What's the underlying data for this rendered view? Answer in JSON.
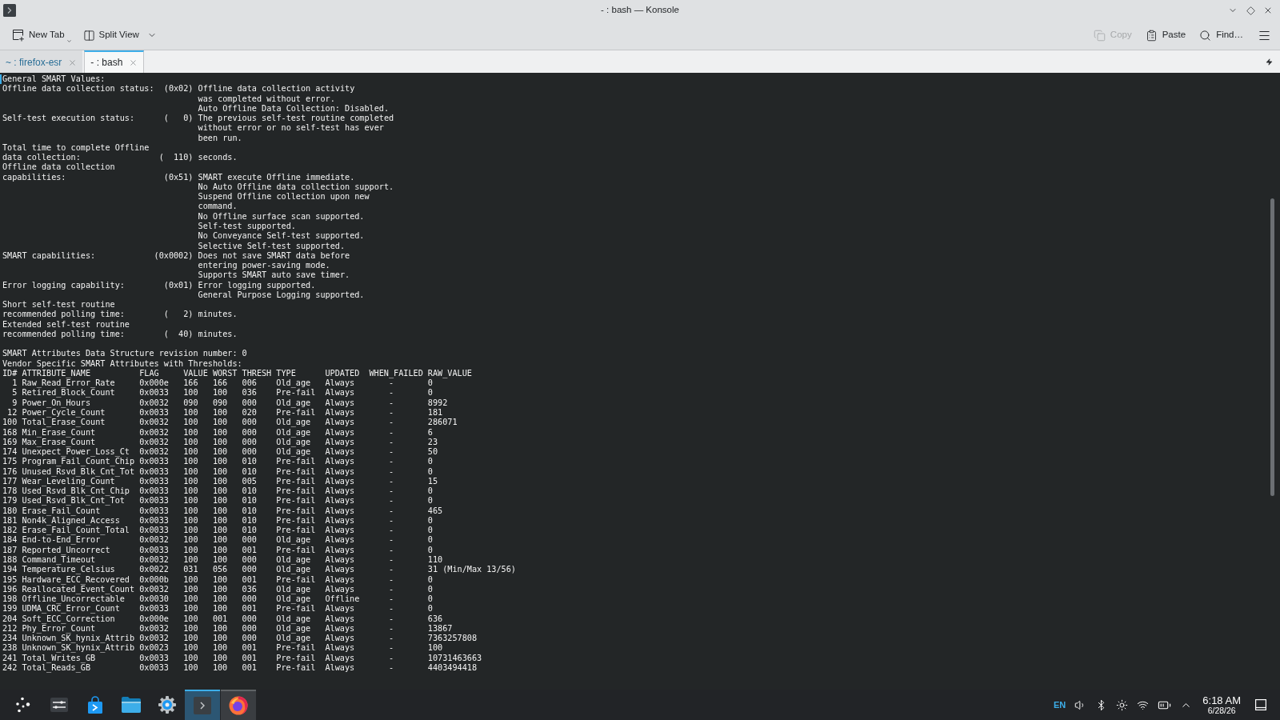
{
  "window": {
    "title": "- : bash — Konsole"
  },
  "toolbar": {
    "buttons": [
      {
        "label": "New Tab"
      },
      {
        "label": "Split View"
      }
    ],
    "actions": [
      {
        "label": "Copy",
        "disabled": true
      },
      {
        "label": "Paste",
        "disabled": false
      },
      {
        "label": "Find…",
        "disabled": false
      }
    ]
  },
  "tabs": [
    {
      "label": "~ : firefox-esr",
      "selected": false
    },
    {
      "label": "- : bash",
      "selected": true
    }
  ],
  "terminal": {
    "smart_values": {
      "heading": "General SMART Values:",
      "entries": [
        {
          "labels": [
            "Offline data collection status:"
          ],
          "code": "(0x02)",
          "description": [
            "Offline data collection activity",
            "was completed without error.",
            "Auto Offline Data Collection: Disabled."
          ]
        },
        {
          "labels": [
            "Self-test execution status:"
          ],
          "code": "(   0)",
          "description": [
            "The previous self-test routine completed",
            "without error or no self-test has ever",
            "been run."
          ]
        },
        {
          "labels": [
            "Total time to complete Offline",
            "data collection:"
          ],
          "code": "(  110)",
          "description": [
            "seconds."
          ]
        },
        {
          "labels": [
            "Offline data collection",
            "capabilities:"
          ],
          "code": "(0x51)",
          "description": [
            "SMART execute Offline immediate.",
            "No Auto Offline data collection support.",
            "Suspend Offline collection upon new",
            "command.",
            "No Offline surface scan supported.",
            "Self-test supported.",
            "No Conveyance Self-test supported.",
            "Selective Self-test supported."
          ]
        },
        {
          "labels": [
            "SMART capabilities:"
          ],
          "code": "(0x0002)",
          "description": [
            "Does not save SMART data before",
            "entering power-saving mode.",
            "Supports SMART auto save timer."
          ]
        },
        {
          "labels": [
            "Error logging capability:"
          ],
          "code": "(0x01)",
          "description": [
            "Error logging supported.",
            "General Purpose Logging supported."
          ]
        },
        {
          "labels": [
            "Short self-test routine",
            "recommended polling time:"
          ],
          "code": "(   2)",
          "description": [
            "minutes."
          ]
        },
        {
          "labels": [
            "Extended self-test routine",
            "recommended polling time:"
          ],
          "code": "(  40)",
          "description": [
            "minutes."
          ]
        }
      ]
    },
    "attributes": {
      "revision": "SMART Attributes Data Structure revision number: 0",
      "heading": "Vendor Specific SMART Attributes with Thresholds:",
      "columns": [
        "ID#",
        "ATTRIBUTE_NAME",
        "FLAG",
        "VALUE",
        "WORST",
        "THRESH",
        "TYPE",
        "UPDATED",
        "WHEN_FAILED",
        "RAW_VALUE"
      ],
      "rows": [
        [
          "1",
          "Raw_Read_Error_Rate",
          "0x000e",
          "166",
          "166",
          "006",
          "Old_age",
          "Always",
          "-",
          "0"
        ],
        [
          "5",
          "Retired_Block_Count",
          "0x0033",
          "100",
          "100",
          "036",
          "Pre-fail",
          "Always",
          "-",
          "0"
        ],
        [
          "9",
          "Power_On_Hours",
          "0x0032",
          "090",
          "090",
          "000",
          "Old_age",
          "Always",
          "-",
          "8992"
        ],
        [
          "12",
          "Power_Cycle_Count",
          "0x0033",
          "100",
          "100",
          "020",
          "Pre-fail",
          "Always",
          "-",
          "181"
        ],
        [
          "100",
          "Total_Erase_Count",
          "0x0032",
          "100",
          "100",
          "000",
          "Old_age",
          "Always",
          "-",
          "286071"
        ],
        [
          "168",
          "Min_Erase_Count",
          "0x0032",
          "100",
          "100",
          "000",
          "Old_age",
          "Always",
          "-",
          "6"
        ],
        [
          "169",
          "Max_Erase_Count",
          "0x0032",
          "100",
          "100",
          "000",
          "Old_age",
          "Always",
          "-",
          "23"
        ],
        [
          "174",
          "Unexpect_Power_Loss_Ct",
          "0x0032",
          "100",
          "100",
          "000",
          "Old_age",
          "Always",
          "-",
          "50"
        ],
        [
          "175",
          "Program_Fail_Count_Chip",
          "0x0033",
          "100",
          "100",
          "010",
          "Pre-fail",
          "Always",
          "-",
          "0"
        ],
        [
          "176",
          "Unused_Rsvd_Blk_Cnt_Tot",
          "0x0033",
          "100",
          "100",
          "010",
          "Pre-fail",
          "Always",
          "-",
          "0"
        ],
        [
          "177",
          "Wear_Leveling_Count",
          "0x0033",
          "100",
          "100",
          "005",
          "Pre-fail",
          "Always",
          "-",
          "15"
        ],
        [
          "178",
          "Used_Rsvd_Blk_Cnt_Chip",
          "0x0033",
          "100",
          "100",
          "010",
          "Pre-fail",
          "Always",
          "-",
          "0"
        ],
        [
          "179",
          "Used_Rsvd_Blk_Cnt_Tot",
          "0x0033",
          "100",
          "100",
          "010",
          "Pre-fail",
          "Always",
          "-",
          "0"
        ],
        [
          "180",
          "Erase_Fail_Count",
          "0x0033",
          "100",
          "100",
          "010",
          "Pre-fail",
          "Always",
          "-",
          "465"
        ],
        [
          "181",
          "Non4k_Aligned_Access",
          "0x0033",
          "100",
          "100",
          "010",
          "Pre-fail",
          "Always",
          "-",
          "0"
        ],
        [
          "182",
          "Erase_Fail_Count_Total",
          "0x0033",
          "100",
          "100",
          "010",
          "Pre-fail",
          "Always",
          "-",
          "0"
        ],
        [
          "184",
          "End-to-End_Error",
          "0x0032",
          "100",
          "100",
          "000",
          "Old_age",
          "Always",
          "-",
          "0"
        ],
        [
          "187",
          "Reported_Uncorrect",
          "0x0033",
          "100",
          "100",
          "001",
          "Pre-fail",
          "Always",
          "-",
          "0"
        ],
        [
          "188",
          "Command_Timeout",
          "0x0032",
          "100",
          "100",
          "000",
          "Old_age",
          "Always",
          "-",
          "110"
        ],
        [
          "194",
          "Temperature_Celsius",
          "0x0022",
          "031",
          "056",
          "000",
          "Old_age",
          "Always",
          "-",
          "31 (Min/Max 13/56)"
        ],
        [
          "195",
          "Hardware_ECC_Recovered",
          "0x000b",
          "100",
          "100",
          "001",
          "Pre-fail",
          "Always",
          "-",
          "0"
        ],
        [
          "196",
          "Reallocated_Event_Count",
          "0x0032",
          "100",
          "100",
          "036",
          "Old_age",
          "Always",
          "-",
          "0"
        ],
        [
          "198",
          "Offline_Uncorrectable",
          "0x0030",
          "100",
          "100",
          "000",
          "Old_age",
          "Offline",
          "-",
          "0"
        ],
        [
          "199",
          "UDMA_CRC_Error_Count",
          "0x0033",
          "100",
          "100",
          "001",
          "Pre-fail",
          "Always",
          "-",
          "0"
        ],
        [
          "204",
          "Soft_ECC_Correction",
          "0x000e",
          "100",
          "001",
          "000",
          "Old_age",
          "Always",
          "-",
          "636"
        ],
        [
          "212",
          "Phy_Error_Count",
          "0x0032",
          "100",
          "100",
          "000",
          "Old_age",
          "Always",
          "-",
          "13867"
        ],
        [
          "234",
          "Unknown_SK_hynix_Attrib",
          "0x0032",
          "100",
          "100",
          "000",
          "Old_age",
          "Always",
          "-",
          "7363257808"
        ],
        [
          "238",
          "Unknown_SK_hynix_Attrib",
          "0x0023",
          "100",
          "100",
          "001",
          "Pre-fail",
          "Always",
          "-",
          "100"
        ],
        [
          "241",
          "Total_Writes_GB",
          "0x0033",
          "100",
          "100",
          "001",
          "Pre-fail",
          "Always",
          "-",
          "10731463663"
        ],
        [
          "242",
          "Total_Reads_GB",
          "0x0033",
          "100",
          "100",
          "001",
          "Pre-fail",
          "Always",
          "-",
          "4403494418"
        ]
      ]
    }
  },
  "taskbar": {
    "tasks": [
      {
        "selected": true
      },
      {
        "selected": false
      }
    ],
    "tray": {
      "keyboard_layout": "EN",
      "time": "6:18 AM",
      "date": "6/28/26"
    }
  }
}
